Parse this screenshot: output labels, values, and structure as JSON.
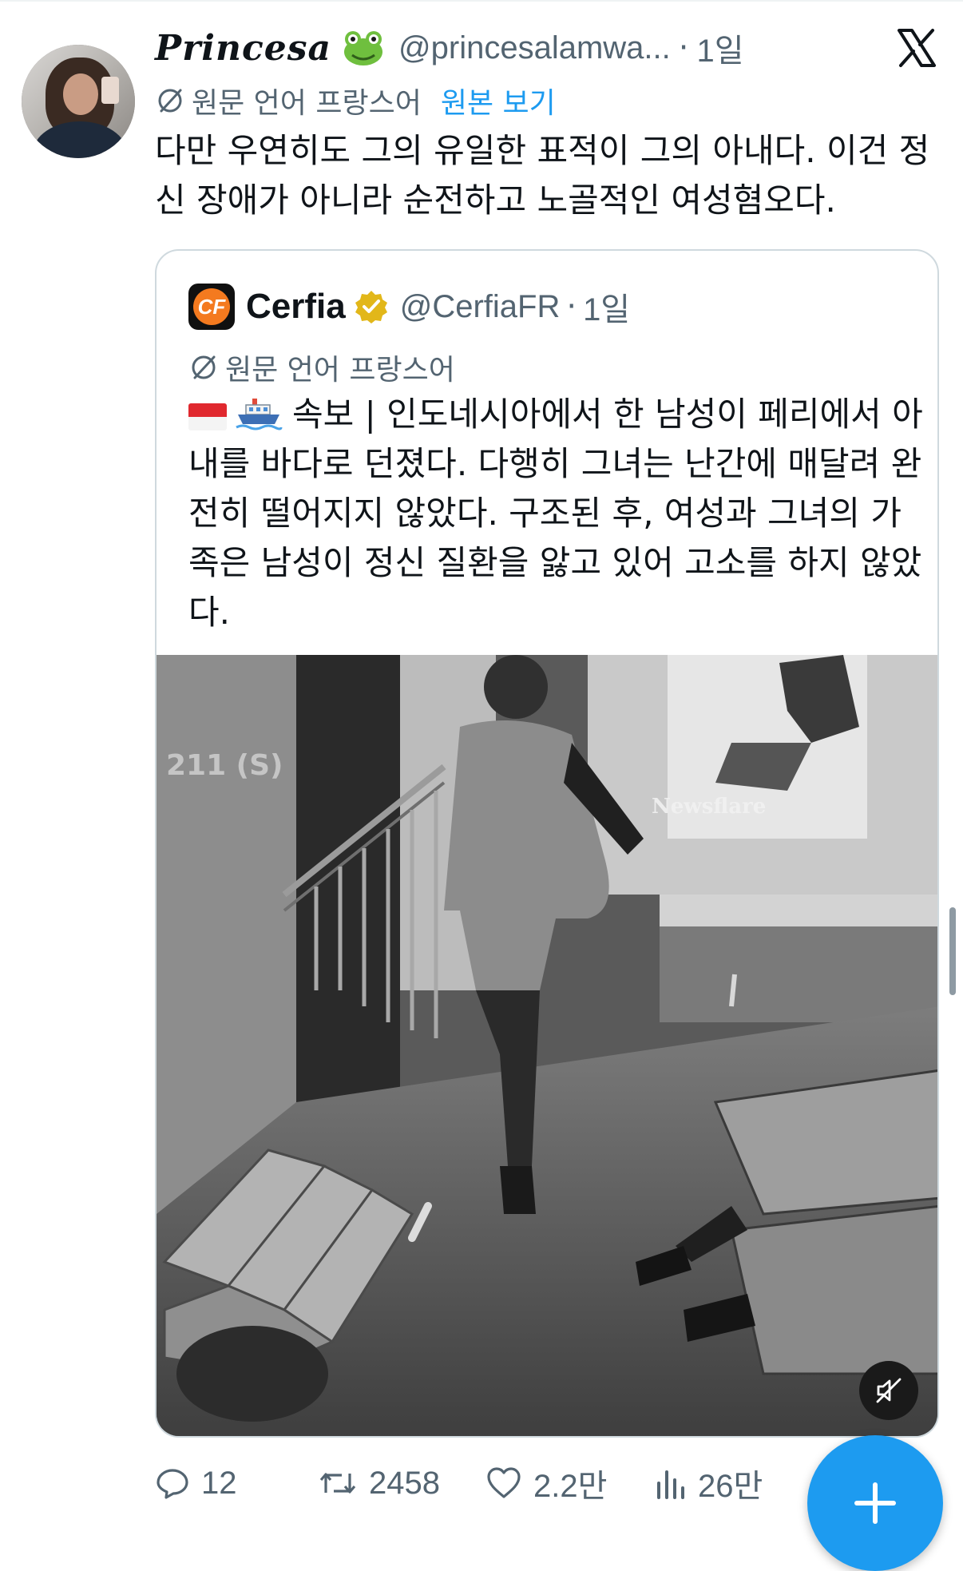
{
  "tweet": {
    "author_name": "Princesa",
    "author_emoji": "frog-face",
    "handle": "@princesalamwa...",
    "separator": "·",
    "time": "1일",
    "translated_from": "원문 언어 프랑스어",
    "show_original": "원본 보기",
    "text": "다만 우연히도 그의 유일한 표적이 그의 아내다. 이건 정신 장애가 아니라 순전하고 노골적인 여성혐오다."
  },
  "quote": {
    "name": "Cerfia",
    "logo_text": "CF",
    "handle": "@CerfiaFR",
    "separator": "·",
    "time": "1일",
    "translated_from": "원문 언어 프랑스어",
    "text": "속보 | 인도네시아에서 한 남성이 페리에서 아내를 바다로 던졌다. 다행히 그녀는 난간에 매달려 완전히 떨어지지 않았다. 구조된 후, 여성과 그녀의 가족은 남성이 정신 질환을 앓고 있어 고소를 하지 않았다.",
    "video_watermark": "Newsflare",
    "video_label": "211 (S)"
  },
  "actions": {
    "reply_count": "12",
    "repost_count": "2458",
    "like_count": "2.2만",
    "view_count": "26만"
  },
  "colors": {
    "accent": "#1d9bf0",
    "secondary_text": "#536471",
    "border": "#cfd9de",
    "verified_gold": "#e2b719"
  }
}
